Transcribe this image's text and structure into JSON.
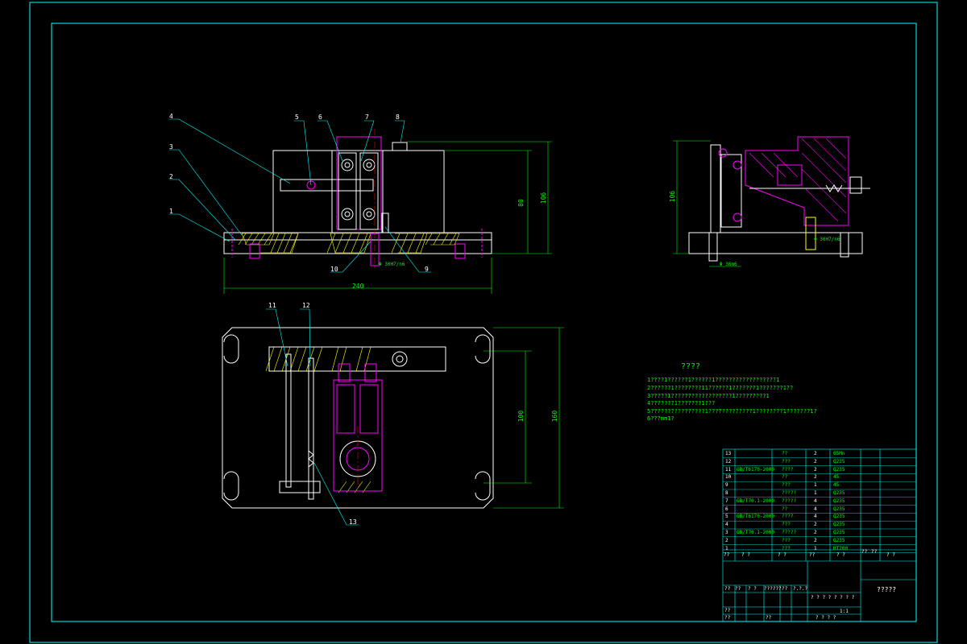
{
  "drawing": {
    "balloons": [
      "1",
      "2",
      "3",
      "4",
      "5",
      "6",
      "7",
      "8",
      "9",
      "10",
      "11",
      "12",
      "13"
    ],
    "dimensions": {
      "front_width": "240",
      "front_height_inner": "80",
      "front_height_outer": "106",
      "front_fit": "Φ 30H7/n6",
      "side_height": "106",
      "side_fit_a": "Φ 30H7/n6",
      "side_fit_b": "Φ 36m6",
      "plan_height_inner": "100",
      "plan_height_outer": "160"
    }
  },
  "notes": {
    "title": "????",
    "lines": [
      "1????1??????1??????1??????????????????1",
      "2??????1????????11??????1???????1???????1??",
      "3?????1??????????????????1?????????1",
      "4???????1???????1???",
      "5????????????????1?????????????1????????1???????1?",
      "6???mm1?"
    ]
  },
  "parts_table": {
    "rows": [
      {
        "no": "13",
        "std": "",
        "name": "??",
        "qty": "2",
        "mat": "65Mn"
      },
      {
        "no": "12",
        "std": "",
        "name": "???",
        "qty": "2",
        "mat": "Q235"
      },
      {
        "no": "11",
        "std": "GB/T6170-2000",
        "name": "????",
        "qty": "2",
        "mat": "Q235"
      },
      {
        "no": "10",
        "std": "",
        "name": "??",
        "qty": "2",
        "mat": "45"
      },
      {
        "no": "9",
        "std": "",
        "name": "???",
        "qty": "1",
        "mat": "45"
      },
      {
        "no": "8",
        "std": "",
        "name": "?????",
        "qty": "1",
        "mat": "Q235"
      },
      {
        "no": "7",
        "std": "GB/T70.1-2000",
        "name": "?????",
        "qty": "4",
        "mat": "Q235"
      },
      {
        "no": "6",
        "std": "",
        "name": "??",
        "qty": "4",
        "mat": "Q235"
      },
      {
        "no": "5",
        "std": "GB/T6170-2000",
        "name": "????",
        "qty": "4",
        "mat": "Q235"
      },
      {
        "no": "4",
        "std": "",
        "name": "???",
        "qty": "2",
        "mat": "Q235"
      },
      {
        "no": "3",
        "std": "GB/T70.1-2000",
        "name": "?????",
        "qty": "2",
        "mat": "Q235"
      },
      {
        "no": "2",
        "std": "",
        "name": "???",
        "qty": "2",
        "mat": "Q235"
      },
      {
        "no": "1",
        "std": "",
        "name": "???",
        "qty": "1",
        "mat": "HT200"
      }
    ],
    "header": {
      "no": "??",
      "std": "?  ?",
      "name": "?  ?",
      "qty": "??",
      "mat": "?  ?",
      "single": "??",
      "total": "??",
      "remark": "?  ?"
    }
  },
  "title_block": {
    "drawing_name": "?????",
    "sign_row": [
      "??",
      "??",
      "?  ?",
      "??????",
      "??",
      "?.?.?"
    ],
    "roles": [
      "??",
      "??",
      "??",
      "??"
    ],
    "stage_labels": [
      "?",
      "?",
      "?",
      "?",
      "?",
      "?",
      "?",
      "?"
    ],
    "scale": "1:1",
    "sheet_labels": [
      "?",
      "?",
      "?",
      "?"
    ]
  },
  "colors": {
    "border": "#00ffff",
    "outline": "#ffffff",
    "dimension": "#00ff00",
    "leader": "#00ffff",
    "hidden": "#ff00ff",
    "hatch": "#ff00ff",
    "hatch_alt": "#ffff00"
  }
}
